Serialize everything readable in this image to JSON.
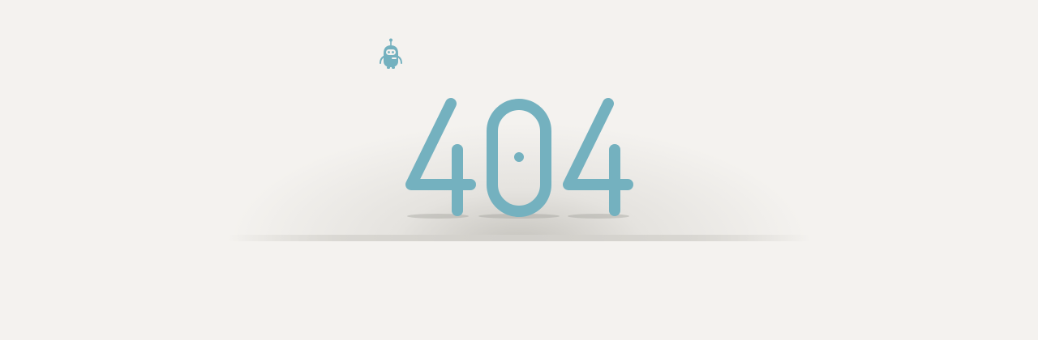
{
  "error": {
    "code": "404"
  },
  "colors": {
    "background": "#f4f2ef",
    "digit": "#74b1bf",
    "digit_shade": "#5d9aa9",
    "robot": "#74b1bf"
  },
  "icons": {
    "mascot": "robot-icon"
  }
}
